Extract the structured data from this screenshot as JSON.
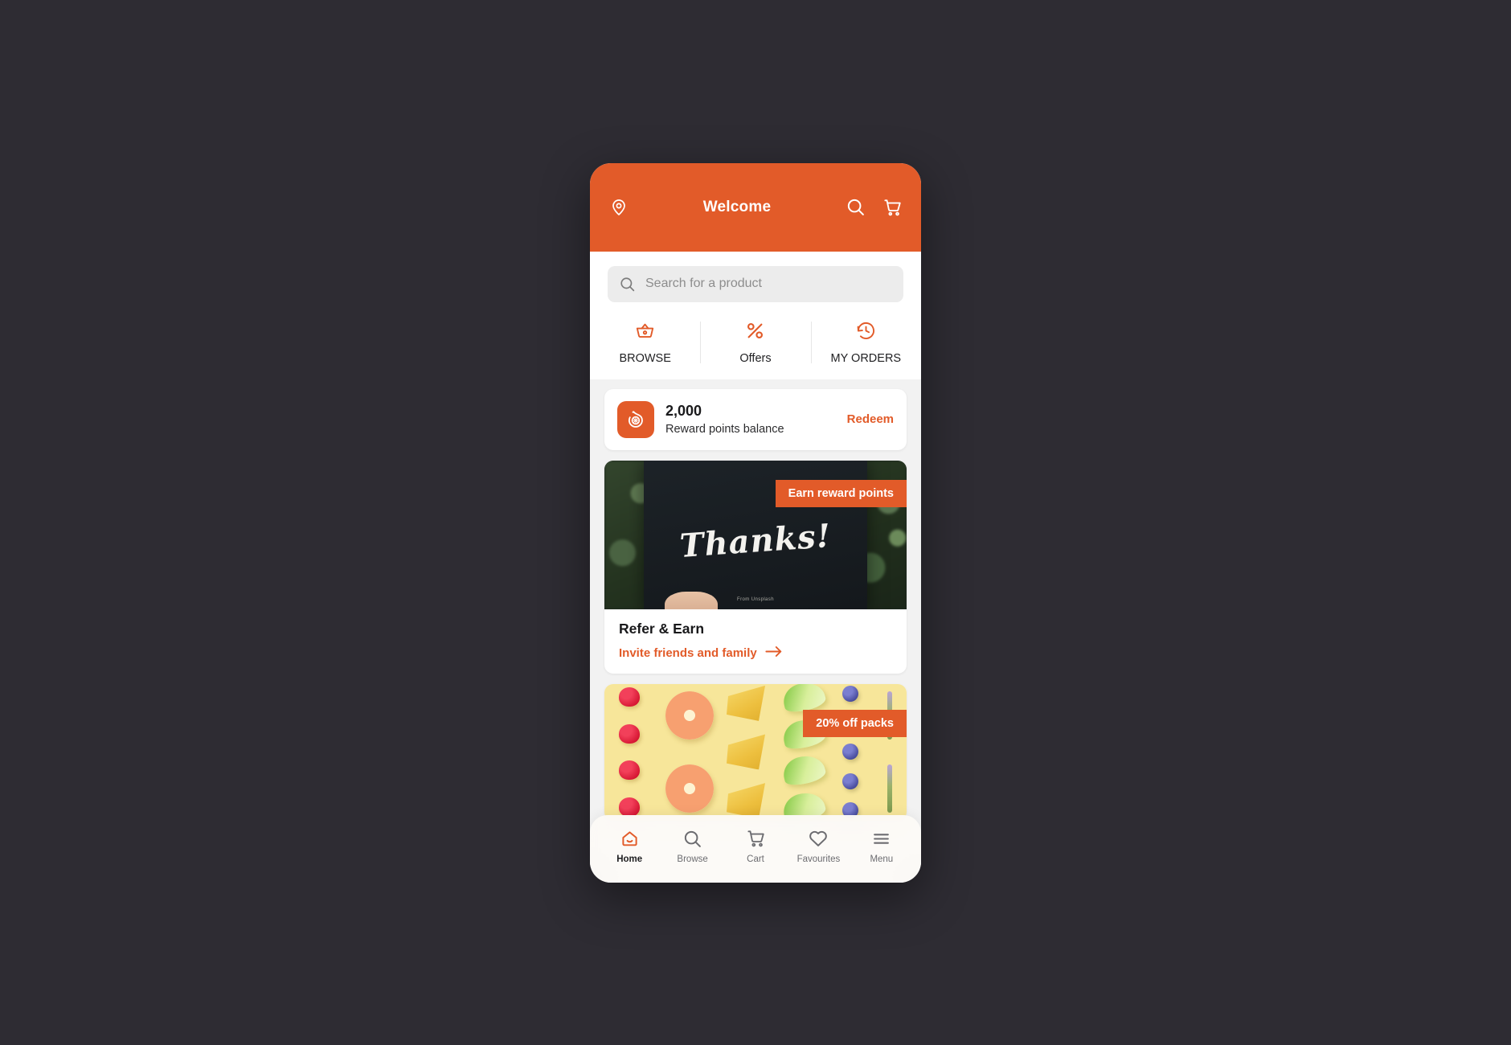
{
  "theme": {
    "brand_orange": "#e25b29",
    "page_background": "#2e2c33",
    "surface": "#ffffff",
    "muted_surface": "#f2f2f2"
  },
  "header": {
    "title": "Welcome",
    "location_icon": "location-pin-icon",
    "search_icon": "search-icon",
    "cart_icon": "shopping-cart-icon"
  },
  "search": {
    "placeholder": "Search for a product",
    "value": "",
    "icon": "search-icon"
  },
  "quick_actions": [
    {
      "label": "BROWSE",
      "icon": "shopping-basket-icon"
    },
    {
      "label": "Offers",
      "icon": "percent-discount-icon"
    },
    {
      "label": "MY ORDERS",
      "icon": "clock-history-icon"
    }
  ],
  "rewards": {
    "logo_icon": "brand-b-logo-icon",
    "points": "2,000",
    "caption": "Reward points balance",
    "action_label": "Redeem"
  },
  "refer_card": {
    "badge": "Earn reward points",
    "photo_text": "Thanks!",
    "photo_credit": "From Unsplash",
    "title": "Refer & Earn",
    "link_label": "Invite friends and family",
    "link_icon": "arrow-right-icon"
  },
  "offer_banner": {
    "badge": "20% off packs"
  },
  "bottom_nav": {
    "items": [
      {
        "label": "Home",
        "icon": "home-icon",
        "active": true
      },
      {
        "label": "Browse",
        "icon": "search-icon",
        "active": false
      },
      {
        "label": "Cart",
        "icon": "shopping-cart-icon",
        "active": false
      },
      {
        "label": "Favourites",
        "icon": "heart-icon",
        "active": false
      },
      {
        "label": "Menu",
        "icon": "hamburger-menu-icon",
        "active": false
      }
    ]
  }
}
